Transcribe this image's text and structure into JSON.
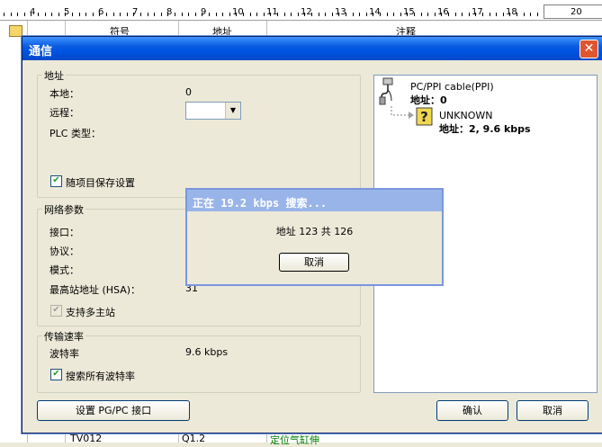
{
  "ruler": {
    "labels": [
      "4",
      "5",
      "6",
      "7",
      "8",
      "9",
      "10",
      "11",
      "12",
      "13",
      "14",
      "15",
      "16",
      "17",
      "18",
      "20"
    ]
  },
  "background_table": {
    "headers": [
      "符号",
      "地址",
      "注释"
    ],
    "bottom_row": [
      "TV012",
      "Q1.2",
      "定位气缸伸"
    ]
  },
  "dialog": {
    "title": "通信",
    "close_label": "✕",
    "address_group": {
      "label": "地址",
      "local_label": "本地：",
      "local_value": "0",
      "remote_label": "远程：",
      "plc_type_label": "PLC 类型：",
      "save_with_project_label": "随项目保存设置",
      "save_with_project_checked": true
    },
    "network_group": {
      "label": "网络参数",
      "interface_label": "接口：",
      "protocol_label": "协议：",
      "mode_label": "模式：",
      "hsa_label": "最高站地址 (HSA)：",
      "hsa_value": "31",
      "multi_master_label": "支持多主站",
      "multi_master_checked": true
    },
    "rate_group": {
      "label": "传输速率",
      "baud_label": "波特率",
      "baud_value": "9.6 kbps",
      "search_all_label": "搜索所有波特率",
      "search_all_checked": true
    },
    "tree": {
      "cable_name": "PC/PPI cable(PPI)",
      "cable_address": "地址：0",
      "device_name": "UNKNOWN",
      "device_address": "地址：2, 9.6 kbps"
    },
    "set_pgpc_label": "设置 PG/PC 接口",
    "ok_label": "确认",
    "cancel_label": "取消"
  },
  "search_popup": {
    "title": "正在 19.2 kbps 搜索...",
    "progress_text": "地址 123 共 126",
    "cancel_label": "取消"
  },
  "colors": {
    "title_bar": "#0054e3",
    "popup_title": "#99b4e8",
    "close_button": "#e0542f"
  }
}
